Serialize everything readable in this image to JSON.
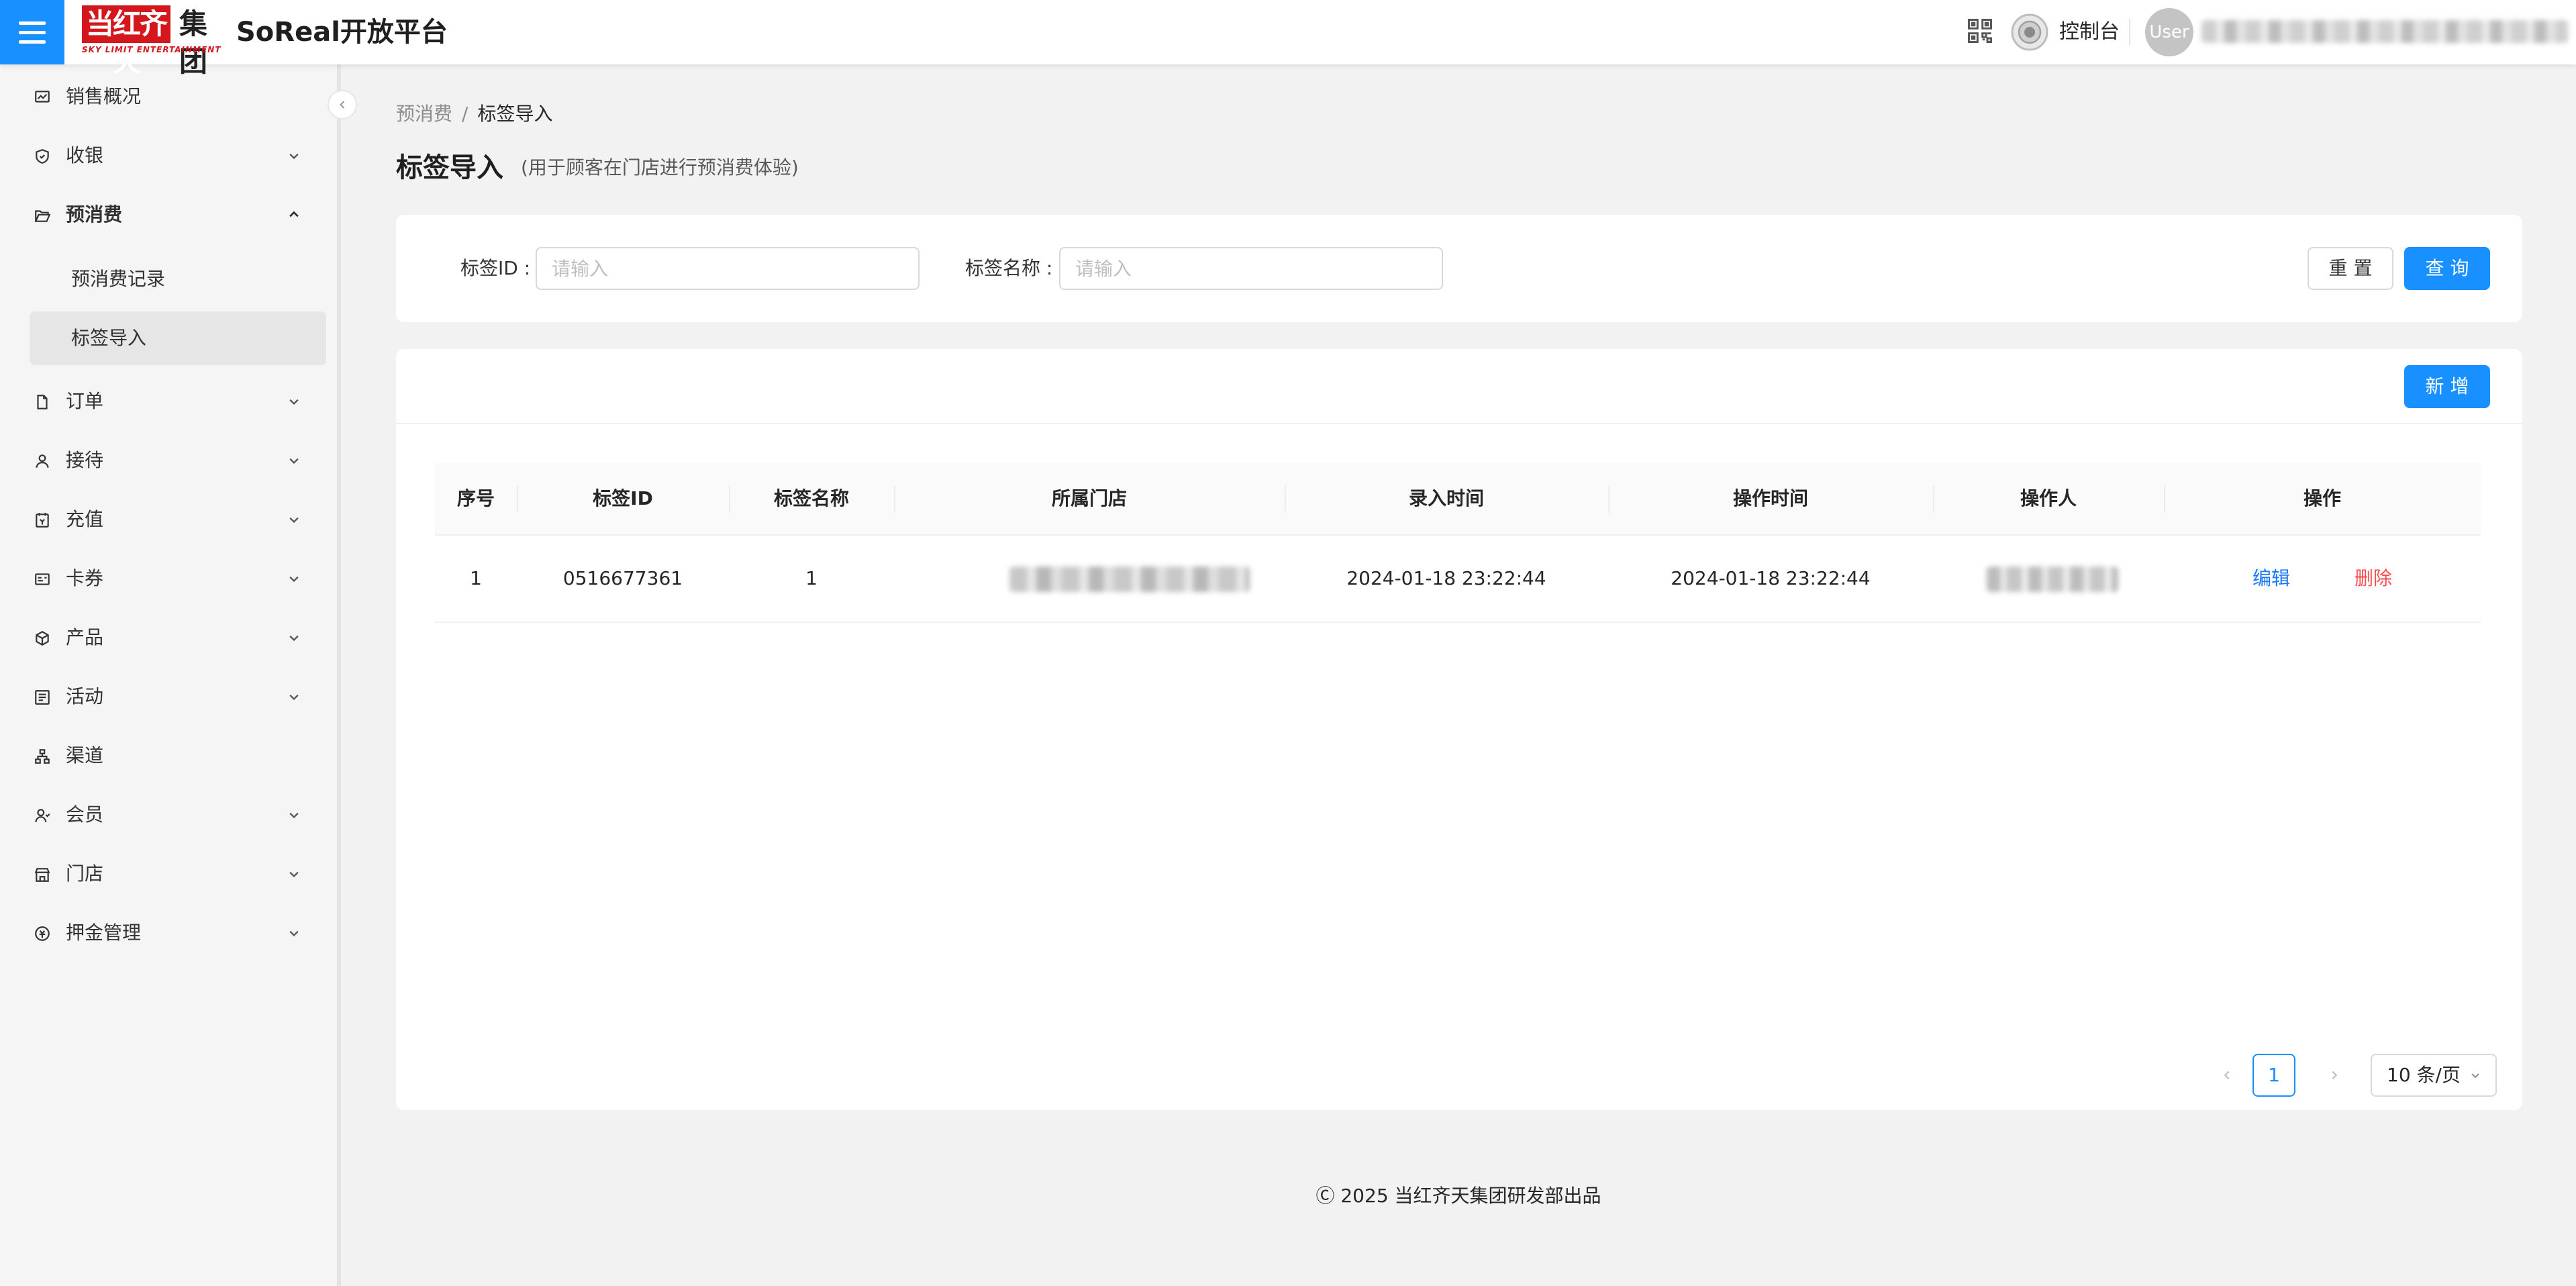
{
  "header": {
    "logo_cn_red": "当红齐天",
    "logo_cn_dark": "集团",
    "logo_en": "SKY LIMIT ENTERTAINMENT",
    "app_title": "SoReal开放平台",
    "console_label": "控制台",
    "avatar_text": "User"
  },
  "sidebar": {
    "items": [
      {
        "label": "销售概况",
        "icon": "chart-icon",
        "chevron": ""
      },
      {
        "label": "收银",
        "icon": "shield-icon",
        "chevron": "down"
      },
      {
        "label": "预消费",
        "icon": "folder-open-icon",
        "chevron": "up"
      },
      {
        "label": "订单",
        "icon": "file-icon",
        "chevron": "down"
      },
      {
        "label": "接待",
        "icon": "user-icon",
        "chevron": "down"
      },
      {
        "label": "充值",
        "icon": "recharge-icon",
        "chevron": "down"
      },
      {
        "label": "卡券",
        "icon": "card-icon",
        "chevron": "down"
      },
      {
        "label": "产品",
        "icon": "product-icon",
        "chevron": "down"
      },
      {
        "label": "活动",
        "icon": "activity-icon",
        "chevron": "down"
      },
      {
        "label": "渠道",
        "icon": "channel-icon",
        "chevron": ""
      },
      {
        "label": "会员",
        "icon": "member-icon",
        "chevron": "down"
      },
      {
        "label": "门店",
        "icon": "store-icon",
        "chevron": "down"
      },
      {
        "label": "押金管理",
        "icon": "deposit-icon",
        "chevron": "down"
      }
    ],
    "subitems": [
      {
        "label": "预消费记录",
        "active": false
      },
      {
        "label": "标签导入",
        "active": true
      }
    ]
  },
  "breadcrumb": {
    "parent": "预消费",
    "separator": "/",
    "current": "标签导入"
  },
  "page": {
    "title": "标签导入",
    "subtitle": "(用于顾客在门店进行预消费体验)"
  },
  "search": {
    "tag_id_label": "标签ID :",
    "tag_id_placeholder": "请输入",
    "tag_name_label": "标签名称 :",
    "tag_name_placeholder": "请输入",
    "reset_label": "重 置",
    "query_label": "查 询"
  },
  "toolbar": {
    "add_label": "新 增"
  },
  "table": {
    "columns": [
      "序号",
      "标签ID",
      "标签名称",
      "所属门店",
      "录入时间",
      "操作时间",
      "操作人",
      "操作"
    ],
    "rows": [
      {
        "index": "1",
        "tag_id": "0516677361",
        "tag_name": "1",
        "created": "2024-01-18 23:22:44",
        "updated": "2024-01-18 23:22:44",
        "edit": "编辑",
        "delete": "删除"
      }
    ]
  },
  "pagination": {
    "current_page": "1",
    "page_size": "10 条/页"
  },
  "footer": {
    "text": "Ⓒ 2025 当红齐天集团研发部出品"
  },
  "colors": {
    "primary": "#1890ff",
    "danger": "#ff4d4f",
    "brand_red": "#d4161d"
  }
}
